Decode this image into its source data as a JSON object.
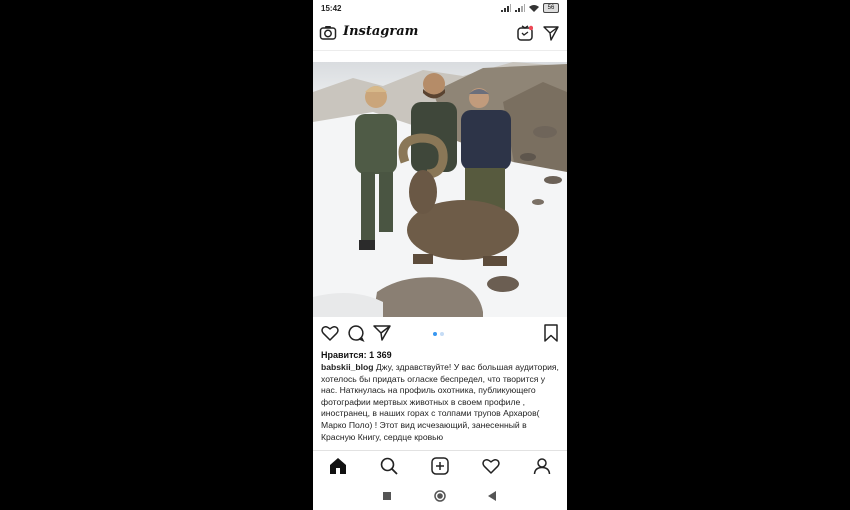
{
  "status_bar": {
    "time": "15:42",
    "battery": "56"
  },
  "top_bar": {
    "brand": "Instagram",
    "camera_icon": "camera-icon",
    "igtv_icon": "igtv-icon",
    "direct_icon": "paper-plane-icon"
  },
  "post": {
    "photo_description_icon": "photo",
    "likes": "Нравится: 1 369",
    "username": "babskii_blog",
    "caption": "Джу, здравствуйте! У вас большая аудитория, хотелось бы придать огласке беспредел, что творится у нас. Наткнулась на профиль охотника, публикующего фотографии мертвых животных в своем профиле , иностранец, в наших горах с толпами трупов Архаров( Марко Поло) ! Этот вид исчезающий, занесенный в Красную Книгу, сердце кровью"
  },
  "actions": {
    "like_icon": "heart-icon",
    "comment_icon": "comment-icon",
    "share_icon": "paper-plane-icon",
    "save_icon": "bookmark-icon"
  },
  "bottom_nav": [
    "home-icon",
    "search-icon",
    "add-post-icon",
    "activity-heart-icon",
    "profile-icon"
  ],
  "system_nav": [
    "recent-apps-icon",
    "home-circle-icon",
    "back-icon"
  ],
  "colors": {
    "accent": "#3897f0",
    "background": "#000000"
  }
}
